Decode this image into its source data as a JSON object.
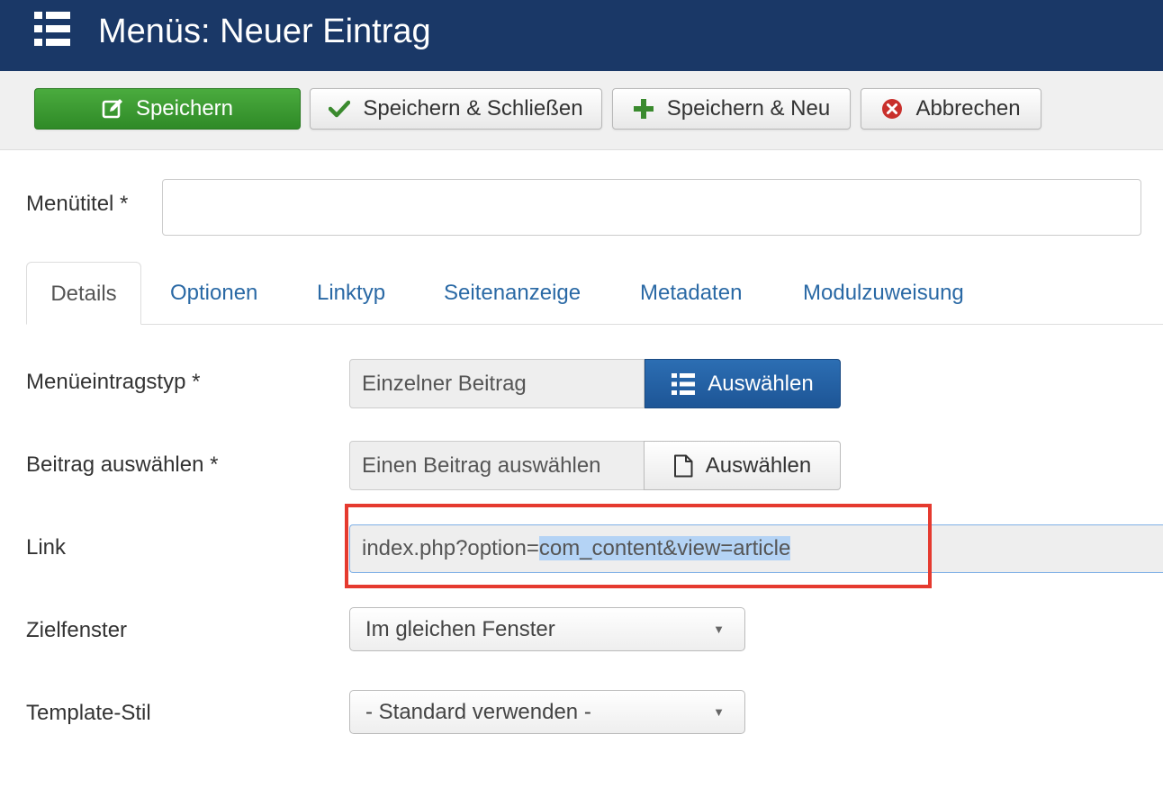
{
  "header": {
    "title": "Menüs: Neuer Eintrag",
    "icon": "list-icon",
    "background": "#1a3867"
  },
  "toolbar": {
    "save_label": "Speichern",
    "save_close_label": "Speichern & Schließen",
    "save_new_label": "Speichern & Neu",
    "cancel_label": "Abbrechen",
    "save_color": "#3a9a31"
  },
  "form": {
    "menu_title_label": "Menütitel *",
    "menu_title_value": ""
  },
  "tabs": [
    {
      "label": "Details",
      "active": true
    },
    {
      "label": "Optionen",
      "active": false
    },
    {
      "label": "Linktyp",
      "active": false
    },
    {
      "label": "Seitenanzeige",
      "active": false
    },
    {
      "label": "Metadaten",
      "active": false
    },
    {
      "label": "Modulzuweisung",
      "active": false
    }
  ],
  "details": {
    "item_type_label": "Menüeintragstyp *",
    "item_type_value": "Einzelner Beitrag",
    "item_type_button": "Auswählen",
    "article_label": "Beitrag auswählen *",
    "article_value": "Einen Beitrag auswählen",
    "article_button": "Auswählen",
    "link_label": "Link",
    "link_prefix": "index.php?option=",
    "link_selected": "com_content&view=article",
    "target_label": "Zielfenster",
    "target_value": "Im gleichen Fenster",
    "template_label": "Template-Stil",
    "template_value": "- Standard verwenden -"
  },
  "annotation": {
    "highlight_color": "#e53a2f"
  }
}
